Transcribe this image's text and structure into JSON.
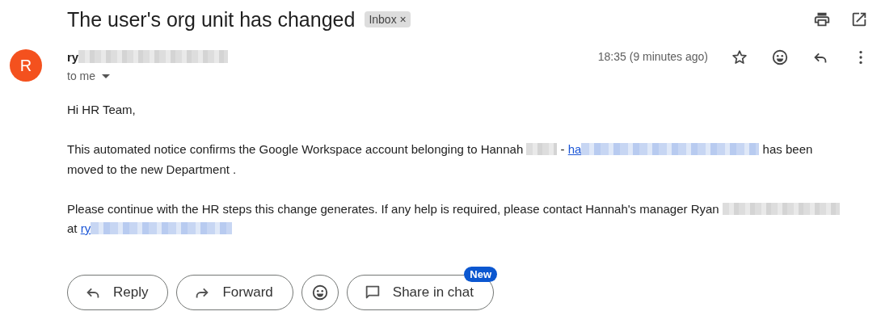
{
  "subject": "The user's org unit has changed",
  "label": {
    "text": "Inbox",
    "remove": "×"
  },
  "sender": {
    "initial": "R",
    "name": "ry",
    "name_redacted": true,
    "recipient": "to me",
    "time": "18:35 (9 minutes ago)"
  },
  "body": [
    [
      {
        "kind": "text",
        "text": "Hi HR Team,"
      }
    ],
    [
      {
        "kind": "text",
        "text": "This automated notice confirms the Google Workspace account belonging to Hannah "
      },
      {
        "kind": "redacted"
      },
      {
        "kind": "text",
        "text": " - "
      },
      {
        "kind": "link",
        "text": "ha"
      },
      {
        "kind": "redacted_link"
      },
      {
        "kind": "text",
        "text": " has been moved to the new Department ."
      }
    ],
    [
      {
        "kind": "text",
        "text": "Please continue with the HR steps this change generates. If any help is required, please contact Hannah's manager Ryan "
      },
      {
        "kind": "redacted"
      },
      {
        "kind": "text",
        "text": " at "
      },
      {
        "kind": "link",
        "text": "ry"
      },
      {
        "kind": "redacted_link"
      }
    ]
  ],
  "actions": [
    {
      "kind": "reply",
      "label": "Reply"
    },
    {
      "kind": "forward",
      "label": "Forward"
    },
    {
      "kind": "emoji"
    },
    {
      "kind": "chat",
      "label": "Share in chat",
      "badge": "New"
    }
  ]
}
